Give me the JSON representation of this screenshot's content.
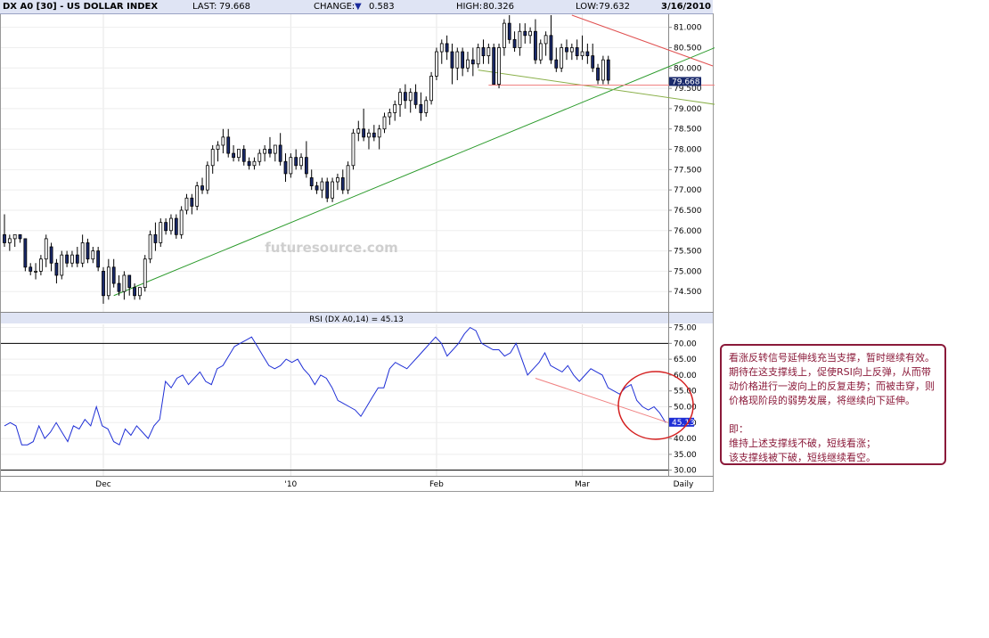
{
  "header": {
    "symbol": "DX A0 [30] - US DOLLAR INDEX",
    "last_label": "LAST:",
    "last_value": "79.668",
    "change_label": "CHANGE:",
    "change_arrow": "▼",
    "change_value": "0.583",
    "high_label": "HIGH:",
    "high_value": "80.326",
    "low_label": "LOW:",
    "low_value": "79.632",
    "date": "3/16/2010"
  },
  "watermark": "futuresource.com",
  "rsi_title": "RSI (DX A0,14) = 45.13",
  "last_price_tag": "79.668",
  "rsi_value_tag": "45.13",
  "period_label": "Daily",
  "note": {
    "paragraph1": "看涨反转信号延伸线充当支撑，暂时继续有效。期待在这支撑线上，促使RSI向上反弹，从而带动价格进行一波向上的反复走势；而被击穿，则价格现阶段的弱势发展，将继续向下延伸。",
    "heading": "即：",
    "line1": "维持上述支撑线不破，短线看涨；",
    "line2": "该支撑线被下破，短线继续看空。"
  },
  "colors": {
    "up_candle": "#ffffff",
    "down_candle": "#1a2a6c",
    "rsi_line": "#1f2fd6",
    "trend_green": "#2a9a2a",
    "trend_red": "#e05050",
    "annotation": "#8b1a3a"
  },
  "chart_data": [
    {
      "type": "candlestick",
      "title": "DX A0 [30] - US DOLLAR INDEX",
      "yticks": [
        74.5,
        75.0,
        75.5,
        76.0,
        76.5,
        77.0,
        77.5,
        78.0,
        78.5,
        79.0,
        79.5,
        80.0,
        80.5,
        81.0
      ],
      "ylim": [
        74.0,
        81.3
      ],
      "x_tick_labels": [
        "Dec",
        "'10",
        "Feb",
        "Mar"
      ],
      "x_tick_index": [
        19,
        55,
        83,
        111
      ],
      "count": 128,
      "ohlc": [
        [
          75.9,
          76.4,
          75.6,
          75.7
        ],
        [
          75.7,
          75.9,
          75.5,
          75.8
        ],
        [
          75.8,
          75.9,
          75.6,
          75.9
        ],
        [
          75.9,
          75.9,
          75.7,
          75.8
        ],
        [
          75.8,
          75.8,
          75.0,
          75.1
        ],
        [
          75.1,
          75.2,
          74.9,
          75.0
        ],
        [
          75.0,
          75.2,
          74.8,
          75.0
        ],
        [
          75.0,
          75.4,
          74.9,
          75.3
        ],
        [
          75.3,
          75.9,
          75.1,
          75.8
        ],
        [
          75.6,
          75.7,
          75.0,
          75.2
        ],
        [
          75.2,
          75.3,
          74.7,
          74.9
        ],
        [
          74.9,
          75.5,
          74.8,
          75.4
        ],
        [
          75.4,
          75.5,
          75.1,
          75.2
        ],
        [
          75.2,
          75.5,
          75.1,
          75.4
        ],
        [
          75.4,
          75.6,
          75.1,
          75.2
        ],
        [
          75.2,
          75.9,
          75.1,
          75.7
        ],
        [
          75.7,
          75.8,
          75.2,
          75.3
        ],
        [
          75.3,
          75.6,
          75.2,
          75.5
        ],
        [
          75.5,
          75.6,
          75.0,
          75.1
        ],
        [
          75.0,
          75.1,
          74.2,
          74.4
        ],
        [
          74.4,
          75.3,
          74.3,
          75.1
        ],
        [
          75.1,
          75.3,
          74.6,
          74.7
        ],
        [
          74.7,
          74.9,
          74.4,
          74.5
        ],
        [
          74.5,
          75.0,
          74.3,
          74.9
        ],
        [
          74.9,
          74.9,
          74.4,
          74.6
        ],
        [
          74.6,
          74.7,
          74.3,
          74.4
        ],
        [
          74.4,
          74.6,
          74.3,
          74.6
        ],
        [
          74.6,
          75.4,
          74.5,
          75.3
        ],
        [
          75.3,
          76.0,
          75.2,
          75.9
        ],
        [
          75.9,
          76.2,
          75.5,
          75.7
        ],
        [
          75.7,
          76.3,
          75.6,
          76.2
        ],
        [
          76.2,
          76.3,
          75.9,
          76.0
        ],
        [
          76.0,
          76.4,
          75.9,
          76.3
        ],
        [
          76.3,
          76.4,
          75.8,
          75.9
        ],
        [
          75.9,
          76.6,
          75.8,
          76.5
        ],
        [
          76.5,
          76.9,
          76.4,
          76.8
        ],
        [
          76.8,
          76.9,
          76.4,
          76.6
        ],
        [
          76.6,
          77.2,
          76.5,
          77.1
        ],
        [
          77.1,
          77.3,
          76.9,
          77.0
        ],
        [
          77.0,
          77.7,
          76.9,
          77.6
        ],
        [
          77.6,
          78.1,
          77.4,
          78.0
        ],
        [
          78.0,
          78.2,
          77.7,
          78.1
        ],
        [
          78.1,
          78.5,
          77.9,
          78.3
        ],
        [
          78.3,
          78.5,
          77.8,
          77.9
        ],
        [
          77.9,
          78.1,
          77.7,
          77.8
        ],
        [
          77.8,
          78.0,
          77.7,
          78.0
        ],
        [
          78.0,
          78.1,
          77.6,
          77.7
        ],
        [
          77.7,
          77.8,
          77.5,
          77.6
        ],
        [
          77.6,
          77.8,
          77.5,
          77.7
        ],
        [
          77.7,
          78.0,
          77.6,
          77.9
        ],
        [
          77.9,
          78.1,
          77.7,
          78.0
        ],
        [
          78.0,
          78.3,
          77.8,
          77.9
        ],
        [
          77.9,
          78.1,
          77.7,
          78.1
        ],
        [
          78.1,
          78.4,
          77.6,
          77.7
        ],
        [
          77.7,
          77.9,
          77.2,
          77.4
        ],
        [
          77.4,
          77.9,
          77.3,
          77.8
        ],
        [
          77.8,
          78.0,
          77.5,
          77.6
        ],
        [
          77.6,
          77.9,
          77.5,
          77.8
        ],
        [
          77.8,
          78.2,
          77.3,
          77.4
        ],
        [
          77.3,
          77.5,
          77.0,
          77.1
        ],
        [
          77.1,
          77.2,
          76.9,
          77.0
        ],
        [
          77.0,
          77.3,
          76.8,
          77.2
        ],
        [
          77.2,
          77.3,
          76.7,
          76.8
        ],
        [
          76.8,
          77.3,
          76.7,
          77.2
        ],
        [
          77.2,
          77.4,
          77.0,
          77.3
        ],
        [
          77.3,
          77.5,
          76.9,
          77.0
        ],
        [
          77.0,
          77.7,
          76.9,
          77.6
        ],
        [
          77.6,
          78.5,
          77.5,
          78.4
        ],
        [
          78.4,
          78.7,
          78.2,
          78.5
        ],
        [
          78.5,
          79.0,
          78.2,
          78.3
        ],
        [
          78.3,
          78.5,
          78.0,
          78.4
        ],
        [
          78.4,
          78.6,
          78.2,
          78.3
        ],
        [
          78.3,
          78.6,
          78.0,
          78.5
        ],
        [
          78.5,
          78.9,
          78.4,
          78.8
        ],
        [
          78.8,
          79.0,
          78.6,
          78.9
        ],
        [
          78.9,
          79.2,
          78.7,
          79.1
        ],
        [
          79.1,
          79.5,
          78.8,
          79.4
        ],
        [
          79.4,
          79.6,
          79.0,
          79.2
        ],
        [
          79.2,
          79.5,
          78.9,
          79.4
        ],
        [
          79.4,
          79.6,
          79.0,
          79.1
        ],
        [
          79.1,
          79.4,
          78.7,
          78.9
        ],
        [
          78.9,
          79.3,
          78.8,
          79.2
        ],
        [
          79.2,
          79.9,
          79.1,
          79.8
        ],
        [
          79.8,
          80.5,
          79.7,
          80.4
        ],
        [
          80.4,
          80.7,
          80.1,
          80.6
        ],
        [
          80.6,
          80.8,
          80.2,
          80.4
        ],
        [
          80.4,
          80.6,
          79.6,
          80.0
        ],
        [
          80.0,
          80.5,
          79.7,
          80.4
        ],
        [
          80.4,
          80.5,
          79.8,
          80.0
        ],
        [
          80.0,
          80.4,
          79.9,
          80.2
        ],
        [
          80.2,
          80.5,
          79.8,
          80.1
        ],
        [
          80.1,
          80.6,
          80.0,
          80.5
        ],
        [
          80.5,
          80.7,
          80.1,
          80.3
        ],
        [
          80.3,
          80.6,
          80.1,
          80.5
        ],
        [
          80.5,
          80.6,
          79.7,
          79.6
        ],
        [
          79.6,
          80.6,
          79.5,
          80.5
        ],
        [
          80.5,
          81.2,
          80.3,
          81.1
        ],
        [
          81.1,
          81.3,
          80.6,
          80.7
        ],
        [
          80.7,
          80.9,
          80.4,
          80.5
        ],
        [
          80.5,
          81.1,
          80.3,
          80.9
        ],
        [
          80.9,
          81.1,
          80.6,
          80.8
        ],
        [
          80.8,
          81.0,
          80.6,
          80.9
        ],
        [
          80.9,
          81.2,
          80.1,
          80.2
        ],
        [
          80.2,
          80.7,
          80.1,
          80.6
        ],
        [
          80.6,
          80.9,
          80.3,
          80.8
        ],
        [
          80.8,
          81.3,
          80.1,
          80.2
        ],
        [
          80.2,
          80.5,
          79.9,
          80.0
        ],
        [
          80.0,
          80.6,
          79.9,
          80.5
        ],
        [
          80.5,
          80.7,
          80.2,
          80.4
        ],
        [
          80.4,
          80.6,
          80.2,
          80.5
        ],
        [
          80.5,
          80.7,
          80.2,
          80.3
        ],
        [
          80.3,
          80.8,
          80.2,
          80.4
        ],
        [
          80.4,
          80.6,
          80.1,
          80.3
        ],
        [
          80.3,
          80.6,
          79.9,
          80.0
        ],
        [
          80.0,
          80.1,
          79.6,
          79.7
        ],
        [
          79.7,
          80.3,
          79.6,
          80.2
        ],
        [
          80.2,
          80.3,
          79.6,
          79.7
        ]
      ]
    },
    {
      "type": "line",
      "title": "RSI (DX A0,14) = 45.13",
      "yticks": [
        30,
        35,
        40,
        45,
        50,
        55,
        60,
        65,
        70,
        75
      ],
      "ylim": [
        28.5,
        76
      ],
      "reference_lines": [
        70,
        30
      ],
      "series": [
        {
          "values": [
            44,
            45,
            44,
            38,
            38,
            39,
            44,
            40,
            42,
            45,
            42,
            39,
            44,
            43,
            46,
            44,
            50,
            44,
            43,
            39,
            38,
            43,
            41,
            44,
            42,
            40,
            44,
            46,
            58,
            56,
            59,
            60,
            57,
            59,
            61,
            58,
            57,
            62,
            63,
            66,
            69,
            70,
            71,
            72,
            69,
            66,
            63,
            62,
            63,
            65,
            64,
            65,
            62,
            60,
            57,
            60,
            59,
            56,
            52,
            51,
            50,
            49,
            47,
            50,
            53,
            56,
            56,
            62,
            64,
            63,
            62,
            64,
            66,
            68,
            70,
            72,
            70,
            66,
            68,
            70,
            73,
            75,
            74,
            70,
            69,
            68,
            68,
            66,
            67,
            70,
            65,
            60,
            62,
            64,
            67,
            63,
            62,
            61,
            63,
            60,
            58,
            60,
            62,
            61,
            60,
            56,
            55,
            54,
            56,
            57,
            52,
            50,
            49,
            50,
            48,
            45
          ]
        }
      ]
    }
  ]
}
